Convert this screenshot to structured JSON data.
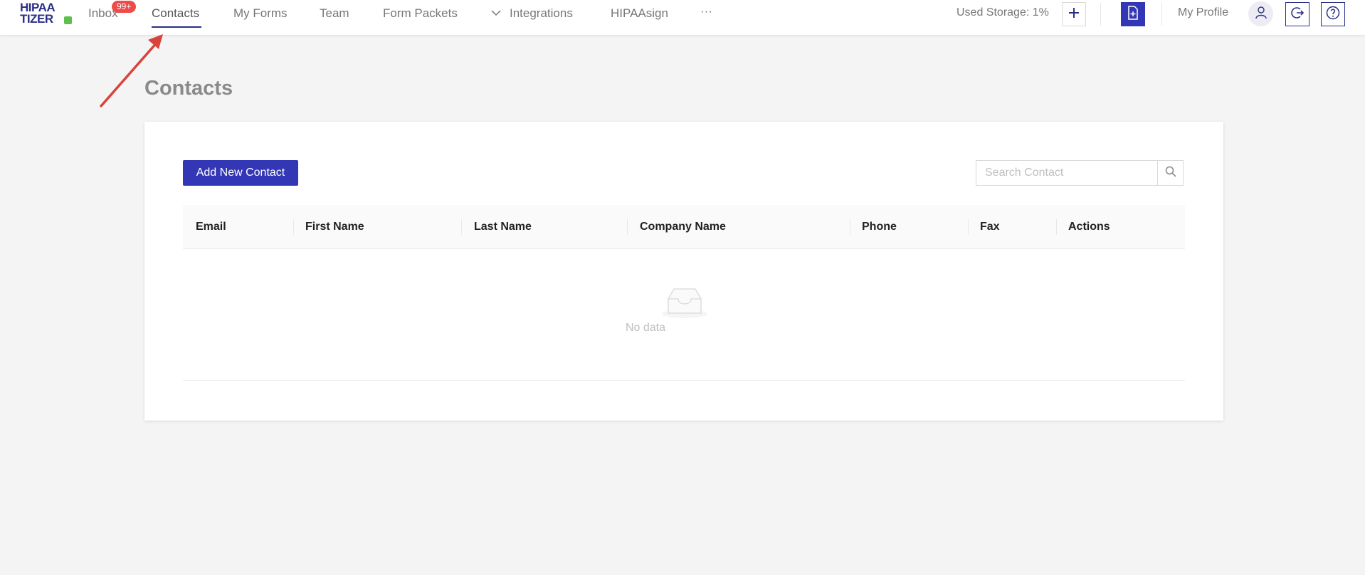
{
  "app": {
    "logo_line1": "HIPAA",
    "logo_line2": "TIZER"
  },
  "nav": {
    "items": [
      {
        "label": "Inbox"
      },
      {
        "label": "Contacts"
      },
      {
        "label": "My Forms"
      },
      {
        "label": "Team"
      },
      {
        "label": "Form Packets"
      },
      {
        "label": "Integrations"
      },
      {
        "label": "HIPAAsign"
      },
      {
        "label": "···"
      }
    ],
    "inbox_badge": "99+",
    "active": "Contacts"
  },
  "header": {
    "storage": "Used Storage: 1%",
    "profile": "My Profile"
  },
  "page": {
    "title": "Contacts"
  },
  "toolbar": {
    "add_label": "Add New Contact",
    "search_placeholder": "Search Contact"
  },
  "table": {
    "columns": [
      "Email",
      "First Name",
      "Last Name",
      "Company Name",
      "Phone",
      "Fax",
      "Actions"
    ],
    "rows": [],
    "empty_text": "No data"
  },
  "colors": {
    "accent": "#3337b5",
    "brand_navy": "#2a2f87",
    "badge": "#ee4b4b",
    "annotation_arrow": "#d9433b"
  }
}
